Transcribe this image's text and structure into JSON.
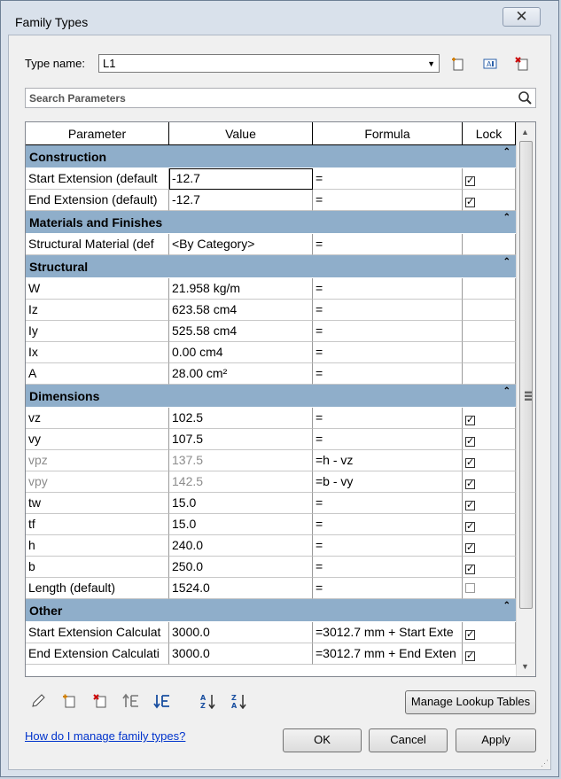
{
  "window": {
    "title": "Family Types",
    "close_label": "✕"
  },
  "type_name": {
    "label": "Type name:",
    "value": "L1"
  },
  "search": {
    "placeholder": "Search Parameters"
  },
  "columns": [
    "Parameter",
    "Value",
    "Formula",
    "Lock"
  ],
  "groups": [
    {
      "name": "Construction",
      "rows": [
        {
          "parameter": "Start Extension (default",
          "value": "-12.7",
          "formula": "=",
          "lock": true
        },
        {
          "parameter": "End Extension (default)",
          "value": "-12.7",
          "formula": "=",
          "lock": true
        }
      ]
    },
    {
      "name": "Materials and Finishes",
      "rows": [
        {
          "parameter": "Structural Material (def",
          "value": "<By Category>",
          "formula": "=",
          "lock": null
        }
      ]
    },
    {
      "name": "Structural",
      "rows": [
        {
          "parameter": "W",
          "value": "21.958 kg/m",
          "formula": "=",
          "lock": null
        },
        {
          "parameter": "Iz",
          "value": "623.58 cm4",
          "formula": "=",
          "lock": null
        },
        {
          "parameter": "Iy",
          "value": "525.58 cm4",
          "formula": "=",
          "lock": null
        },
        {
          "parameter": "Ix",
          "value": "0.00 cm4",
          "formula": "=",
          "lock": null
        },
        {
          "parameter": "A",
          "value": "28.00 cm²",
          "formula": "=",
          "lock": null
        }
      ]
    },
    {
      "name": "Dimensions",
      "rows": [
        {
          "parameter": "vz",
          "value": "102.5",
          "formula": "=",
          "lock": true
        },
        {
          "parameter": "vy",
          "value": "107.5",
          "formula": "=",
          "lock": true
        },
        {
          "parameter": "vpz",
          "value": "137.5",
          "formula": "=h - vz",
          "lock": true,
          "dim": true
        },
        {
          "parameter": "vpy",
          "value": "142.5",
          "formula": "=b - vy",
          "lock": true,
          "dim": true
        },
        {
          "parameter": "tw",
          "value": "15.0",
          "formula": "=",
          "lock": true
        },
        {
          "parameter": "tf",
          "value": "15.0",
          "formula": "=",
          "lock": true
        },
        {
          "parameter": "h",
          "value": "240.0",
          "formula": "=",
          "lock": true
        },
        {
          "parameter": "b",
          "value": "250.0",
          "formula": "=",
          "lock": true
        },
        {
          "parameter": "Length (default)",
          "value": "1524.0",
          "formula": "=",
          "lock": false
        }
      ]
    },
    {
      "name": "Other",
      "rows": [
        {
          "parameter": "Start Extension Calculat",
          "value": "3000.0",
          "formula": "=3012.7 mm + Start Exte",
          "lock": true
        },
        {
          "parameter": "End Extension Calculati",
          "value": "3000.0",
          "formula": "=3012.7 mm + End Exten",
          "lock": true
        }
      ]
    }
  ],
  "buttons": {
    "manage_lookup": "Manage Lookup Tables",
    "ok": "OK",
    "cancel": "Cancel",
    "apply": "Apply"
  },
  "help_link": "How do I manage family types?",
  "icons": [
    "new-type-icon",
    "rename-type-icon",
    "delete-type-icon",
    "edit-parameter-icon",
    "new-parameter-icon",
    "remove-parameter-icon",
    "move-up-icon",
    "move-down-icon",
    "sort-ascending-icon",
    "sort-descending-icon",
    "search-icon"
  ],
  "colors": {
    "group_header": "#8faeca",
    "link": "#0033cc"
  }
}
